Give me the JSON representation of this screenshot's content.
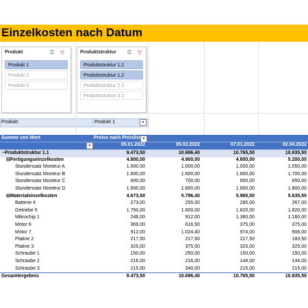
{
  "title": "Einzelkosten nach Datum",
  "slicers": [
    {
      "header": "Produkt",
      "items": [
        {
          "label": "Produkt 1",
          "selected": true
        },
        {
          "label": "Produkt 2",
          "selected": false
        },
        {
          "label": "Produkt 3",
          "selected": false
        }
      ]
    },
    {
      "header": "Produktstruktur",
      "items": [
        {
          "label": "Produktstruktur 1.1",
          "selected": true
        },
        {
          "label": "Produktstruktur 1.2",
          "selected": true
        },
        {
          "label": "Produktstruktur 2.1",
          "selected": false
        },
        {
          "label": "Produktstruktur 3.1",
          "selected": false
        }
      ]
    }
  ],
  "filter": {
    "label": "Produkt",
    "value": "Produkt 1"
  },
  "pivot": {
    "value_header": "Summe von Wert",
    "column_field": "Preise nach Preisliste",
    "dates": [
      "05.01.2022",
      "05.02.2022",
      "07.01.2022",
      "02.04.2022"
    ],
    "rows": [
      {
        "label": "Produktstruktur 1.1",
        "expander": "−",
        "values": [
          "9.473,50",
          "10.696,40",
          "10.765,50",
          "10.835,50"
        ]
      },
      {
        "label": "Fertigungseinzelkosten",
        "expander": "⊟",
        "values": [
          "4.800,00",
          "4.900,00",
          "4.800,00",
          "5.200,00"
        ]
      },
      {
        "label": "Stundensatz Monteur A",
        "values": [
          "1.000,00",
          "1.000,00",
          "1.000,00",
          "1.050,00"
        ]
      },
      {
        "label": "Stundensatz Monteur B",
        "values": [
          "1.600,00",
          "1.600,00",
          "1.600,00",
          "1.700,00"
        ]
      },
      {
        "label": "Stundensatz Monteur C",
        "values": [
          "600,00",
          "700,00",
          "600,00",
          "650,00"
        ]
      },
      {
        "label": "Stundensatz Monteur D",
        "values": [
          "1.600,00",
          "1.600,00",
          "1.600,00",
          "1.800,00"
        ]
      },
      {
        "label": "Materialeinzelkosten",
        "expander": "⊟",
        "values": [
          "4.673,50",
          "5.796,40",
          "5.965,50",
          "5.635,50"
        ]
      },
      {
        "label": "Batterie 4",
        "values": [
          "273,00",
          "255,00",
          "285,00",
          "267,00"
        ]
      },
      {
        "label": "Getriebe 5",
        "values": [
          "1.750,00",
          "1.600,00",
          "1.820,00",
          "1.820,00"
        ]
      },
      {
        "label": "Mikrochip 1",
        "values": [
          "246,00",
          "912,00",
          "1.360,00",
          "1.160,00"
        ]
      },
      {
        "label": "Motor 6",
        "values": [
          "369,00",
          "616,50",
          "375,00",
          "375,00"
        ]
      },
      {
        "label": "Motor 7",
        "values": [
          "912,00",
          "1.024,40",
          "974,00",
          "906,00"
        ]
      },
      {
        "label": "Platine 2",
        "values": [
          "217,50",
          "217,50",
          "217,50",
          "183,50"
        ]
      },
      {
        "label": "Platine 3",
        "values": [
          "325,00",
          "375,00",
          "325,00",
          "325,00"
        ]
      },
      {
        "label": "Schraube 1",
        "values": [
          "150,00",
          "250,00",
          "150,00",
          "150,00"
        ]
      },
      {
        "label": "Schraube 2",
        "values": [
          "216,00",
          "216,00",
          "144,00",
          "144,00"
        ]
      },
      {
        "label": "Schraube 3",
        "values": [
          "215,00",
          "340,00",
          "215,00",
          "215,00"
        ]
      },
      {
        "label": "Gesamtergebnis",
        "values": [
          "9.473,50",
          "10.696,40",
          "10.765,50",
          "10.835,50"
        ]
      }
    ]
  }
}
